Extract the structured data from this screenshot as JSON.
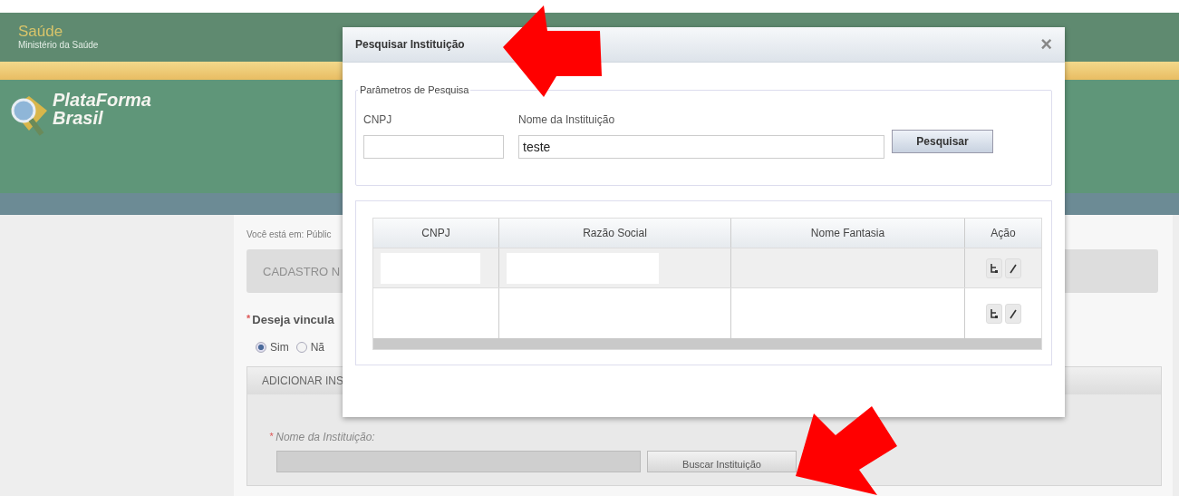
{
  "header": {
    "brand": "Saúde",
    "ministry": "Ministério da Saúde",
    "logo_line_1": "PlataForma",
    "logo_line_2": "Brasil"
  },
  "page": {
    "breadcrumb": "Você está em: Públic",
    "section_title": "CADASTRO N",
    "question": "Deseja vincula",
    "required_mark": "*",
    "radios": [
      {
        "label": "Sim",
        "selected": true
      },
      {
        "label": "Nã",
        "selected": false
      }
    ],
    "panel_title": "ADICIONAR INS",
    "field_label": "Nome da Instituição:",
    "field_required_mark": "*",
    "search_button": "Buscar Instituição"
  },
  "dialog": {
    "title": "Pesquisar Instituição",
    "close": "×",
    "legend": "Parâmetros de Pesquisa",
    "fields": [
      {
        "label": "CNPJ"
      },
      {
        "label": "Nome da Instituição",
        "value": "teste"
      }
    ],
    "search_button": "Pesquisar",
    "table": {
      "columns": [
        "CNPJ",
        "Razão Social",
        "Nome Fantasia",
        "Ação"
      ],
      "rows": [
        {
          "highlighted": true
        },
        {
          "highlighted": false
        }
      ]
    }
  }
}
